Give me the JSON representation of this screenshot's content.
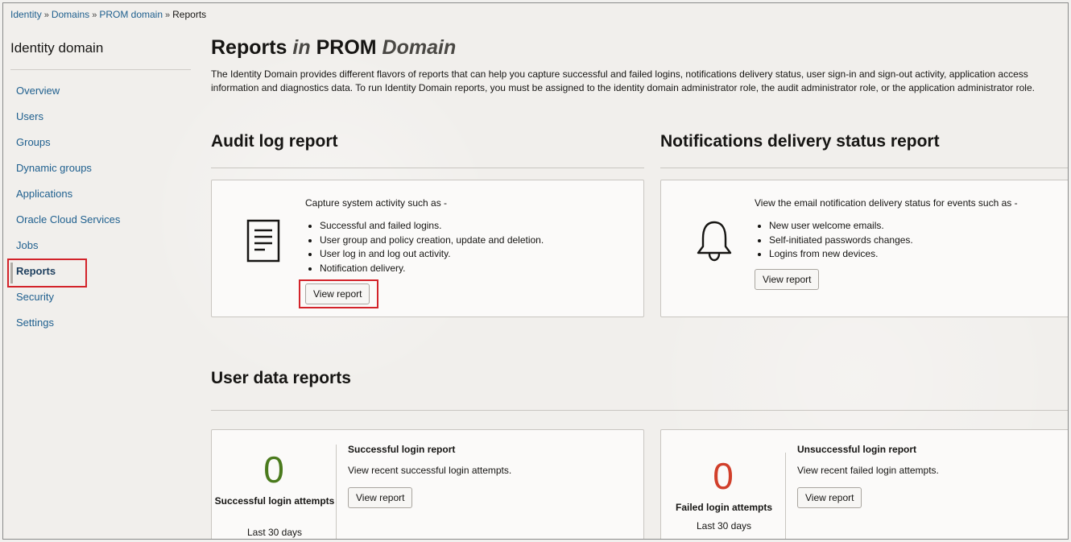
{
  "breadcrumb": {
    "items": [
      "Identity",
      "Domains",
      "PROM domain"
    ],
    "current": "Reports",
    "separator": "»"
  },
  "sidebar": {
    "title": "Identity domain",
    "items": [
      {
        "label": "Overview"
      },
      {
        "label": "Users"
      },
      {
        "label": "Groups"
      },
      {
        "label": "Dynamic groups"
      },
      {
        "label": "Applications"
      },
      {
        "label": "Oracle Cloud Services"
      },
      {
        "label": "Jobs"
      },
      {
        "label": "Reports",
        "active": true
      },
      {
        "label": "Security"
      },
      {
        "label": "Settings"
      }
    ]
  },
  "page": {
    "title_prefix": "Reports",
    "title_in": "in",
    "title_name": "PROM",
    "title_suffix": "Domain",
    "intro": "The Identity Domain provides different flavors of reports that can help you capture successful and failed logins, notifications delivery status, user sign-in and sign-out activity, application access information and diagnostics data. To run Identity Domain reports, you must be assigned to the identity domain administrator role, the audit administrator role, or the application administrator role."
  },
  "audit": {
    "section_title": "Audit log report",
    "icon": "document-icon",
    "lead": "Capture system activity such as -",
    "bullets": [
      "Successful and failed logins.",
      "User group and policy creation, update and deletion.",
      "User log in and log out activity.",
      "Notification delivery."
    ],
    "button": "View report"
  },
  "notifications": {
    "section_title": "Notifications delivery status report",
    "icon": "bell-icon",
    "lead": "View the email notification delivery status for events such as -",
    "bullets": [
      "New user welcome emails.",
      "Self-initiated passwords changes.",
      "Logins from new devices."
    ],
    "button": "View report"
  },
  "user_data": {
    "section_title": "User data reports",
    "success": {
      "count": "0",
      "count_color": "#4a7a1d",
      "label": "Successful login attempts",
      "period": "Last 30 days",
      "report_title": "Successful login report",
      "report_desc": "View recent successful login attempts.",
      "button": "View report"
    },
    "failed": {
      "count": "0",
      "count_color": "#d13f2b",
      "label": "Failed login attempts",
      "period": "Last 30 days",
      "report_title": "Unsuccessful login report",
      "report_desc": "View recent failed login attempts.",
      "button": "View report"
    }
  },
  "colors": {
    "link": "#1e5f8e",
    "highlight": "#d3232a"
  }
}
